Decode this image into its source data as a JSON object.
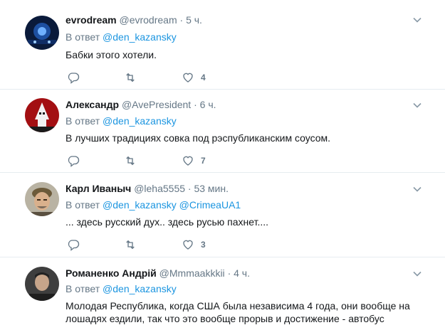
{
  "tweets": [
    {
      "name": "evrodream",
      "handle": "@evrodream",
      "time": "· 5 ч.",
      "reply_prefix": "В ответ",
      "mentions": [
        "@den_kazansky"
      ],
      "text": "Бабки этого хотели.",
      "likes": "4",
      "avatar_color": "#0a1a3a"
    },
    {
      "name": "Александр",
      "handle": "@AvePresident",
      "time": "· 6 ч.",
      "reply_prefix": "В ответ",
      "mentions": [
        "@den_kazansky"
      ],
      "text": "В лучших традициях совка под рэспубликанским соусом.",
      "likes": "7",
      "avatar_color": "#a30f12"
    },
    {
      "name": "Карл Иваныч",
      "handle": "@leha5555",
      "time": "· 53 мин.",
      "reply_prefix": "В ответ",
      "mentions": [
        "@den_kazansky",
        "@CrimeaUA1"
      ],
      "text": "... здесь русский дух.. здесь русью пахнет....",
      "likes": "3",
      "avatar_color": "#8a7a5a"
    },
    {
      "name": "Романенко Андрій",
      "handle": "@Mmmaakkkii",
      "time": "· 4 ч.",
      "reply_prefix": "В ответ",
      "mentions": [
        "@den_kazansky"
      ],
      "text": "Молодая Республика, когда США была независима 4 года, они вообще на лошадях ездили, так что это вообще прорыв и достижение - автобус",
      "likes": "",
      "avatar_color": "#4a4a4a"
    }
  ],
  "colors": {
    "link": "#1b95e0",
    "secondary": "#657786",
    "divider": "#e6ecf0"
  },
  "icons": {
    "reply": "reply-icon",
    "retweet": "retweet-icon",
    "like": "heart-icon",
    "caret": "chevron-down-icon"
  }
}
